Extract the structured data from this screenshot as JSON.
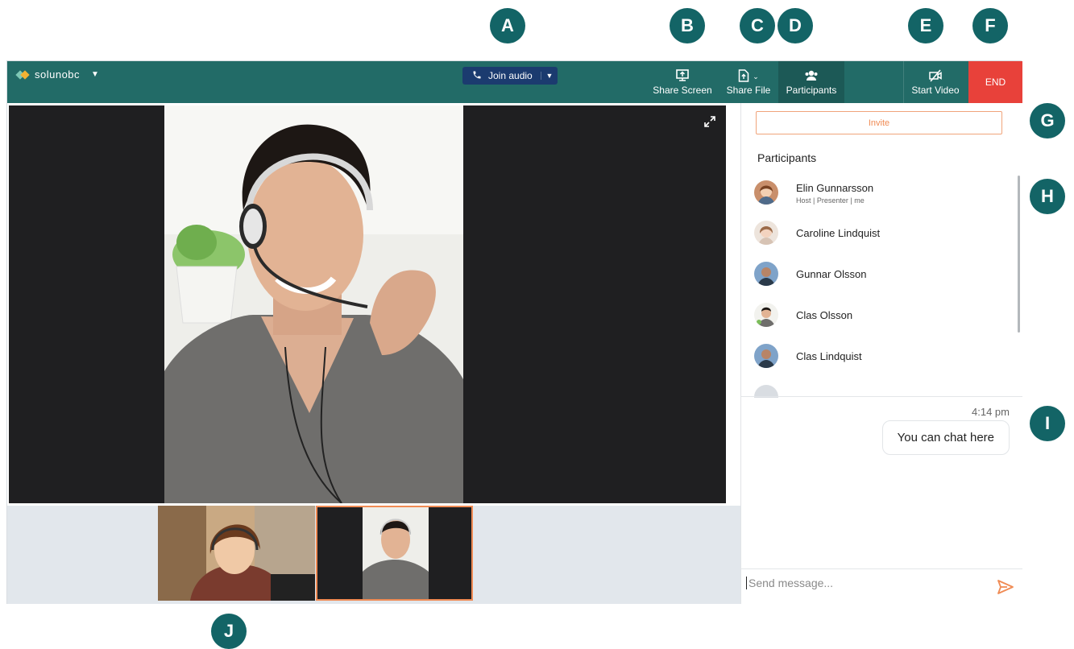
{
  "callouts": {
    "a": "A",
    "b": "B",
    "c": "C",
    "d": "D",
    "e": "E",
    "f": "F",
    "g": "G",
    "h": "H",
    "i": "I",
    "j": "J"
  },
  "header": {
    "logo_text": "solunobc",
    "join_audio_label": "Join audio",
    "share_screen_label": "Share Screen",
    "share_file_label": "Share File",
    "participants_label": "Participants",
    "start_video_label": "Start Video",
    "end_label": "END"
  },
  "sidebar": {
    "invite_label": "Invite",
    "participants_title": "Participants",
    "participants": [
      {
        "name": "Elin Gunnarsson",
        "role": "Host | Presenter | me"
      },
      {
        "name": "Caroline Lindquist"
      },
      {
        "name": "Gunnar Olsson"
      },
      {
        "name": "Clas Olsson"
      },
      {
        "name": "Clas Lindquist"
      }
    ]
  },
  "chat": {
    "time": "4:14 pm",
    "message": "You can chat here",
    "input_placeholder": "Send message..."
  },
  "colors": {
    "header": "#226b67",
    "callout": "#136466",
    "end": "#e8413a",
    "accent": "#f08b54",
    "join": "#1b3b6f"
  },
  "icons": [
    "phone-icon",
    "share-screen-icon",
    "share-file-icon",
    "participants-icon",
    "video-off-icon",
    "expand-icon",
    "send-icon"
  ]
}
